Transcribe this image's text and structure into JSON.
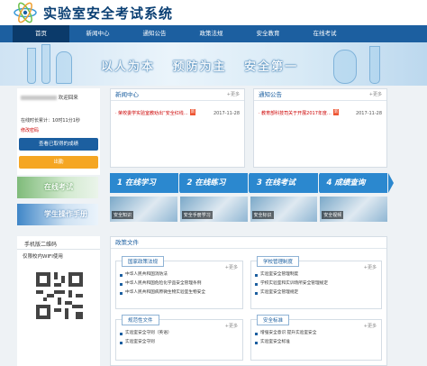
{
  "site": {
    "title": "实验室安全考试系统"
  },
  "nav": {
    "items": [
      "首页",
      "新闻中心",
      "通知公告",
      "政策法规",
      "安全教育",
      "在线考试"
    ],
    "active_index": 0
  },
  "banner": {
    "slogan": "以人为本   预防为主   安全第一"
  },
  "user_panel": {
    "greeting_suffix": "欢迎回来",
    "online_time_label": "在线时长累计：10时11分1秒",
    "edit_password_label": "修改密码",
    "view_scores_button": "查看已取得的成绩",
    "exam_button": "出勤"
  },
  "news": {
    "title": "新闻中心",
    "more_label": "+更多",
    "items": [
      {
        "text": "· 荣校委学实验室教劝出“安全红线…",
        "badge": "新",
        "date": "2017-11-28"
      }
    ]
  },
  "notices": {
    "title": "通知公告",
    "more_label": "+更多",
    "items": [
      {
        "text": "· 教育部科技司关于开展2017年度…",
        "badge": "新",
        "date": "2017-11-28"
      }
    ]
  },
  "side_banners": {
    "online_exam": "在线考试",
    "study_handbook": "学生操作手册"
  },
  "steps": [
    "1 在线学习",
    "2 在线练习",
    "3 在线考试",
    "4 成绩查询"
  ],
  "tiles": [
    "安全知识",
    "安全手册学习",
    "安全标识",
    "安全视频"
  ],
  "qr_panel": {
    "title": "手机版二维码",
    "note": "仅限校内WIFI使用"
  },
  "policy": {
    "title": "政策文件",
    "groups": [
      {
        "name": "国家政策法规",
        "items": [
          "中华人民共和国消防法",
          "中华人民共和国危险化学品安全管理条例",
          "中华人民共和国病原微生物实验室生物安全"
        ]
      },
      {
        "name": "学校管理制度",
        "items": [
          "实验室安全管理制度",
          "学校实验室和实训场所安全管理规定",
          "实验室安全管理规定"
        ]
      },
      {
        "name": "规范性文件",
        "items": [
          "实验室安全守则（英语）",
          "实验室安全守则"
        ]
      },
      {
        "name": "安全标准",
        "items": [
          "增强安全意识 提升实验室安全",
          "实验室安全标准"
        ]
      }
    ],
    "more_label": "+更多"
  },
  "colors": {
    "nav_bg": "#1c5fa0",
    "nav_active": "#0b3a6a",
    "scores_button": "#1c5fa0",
    "exam_button": "#f5a623",
    "steps_bg": "#2b88cf"
  },
  "icons": [
    "logo-atom-icon",
    "qr-code"
  ]
}
